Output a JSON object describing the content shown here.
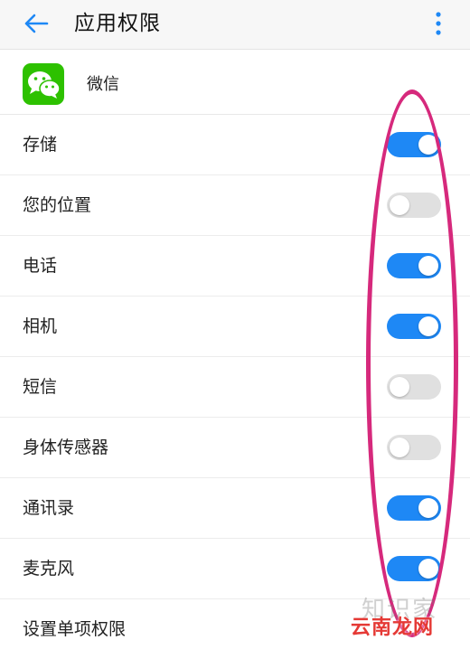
{
  "header": {
    "title": "应用权限",
    "back_icon": "arrow-left-icon",
    "more_icon": "more-vertical-icon"
  },
  "app": {
    "name": "微信",
    "icon": "wechat-icon",
    "icon_color": "#2dc100"
  },
  "permissions": [
    {
      "label": "存储",
      "enabled": true
    },
    {
      "label": "您的位置",
      "enabled": false
    },
    {
      "label": "电话",
      "enabled": true
    },
    {
      "label": "相机",
      "enabled": true
    },
    {
      "label": "短信",
      "enabled": false
    },
    {
      "label": "身体传感器",
      "enabled": false
    },
    {
      "label": "通讯录",
      "enabled": true
    },
    {
      "label": "麦克风",
      "enabled": true
    }
  ],
  "footer_item": {
    "label": "设置单项权限"
  },
  "colors": {
    "accent": "#1e88f5",
    "toggle_off": "#e0e0e0",
    "highlight": "#d6297c"
  },
  "watermark": {
    "faint": "知识家",
    "text": "云南龙网"
  }
}
